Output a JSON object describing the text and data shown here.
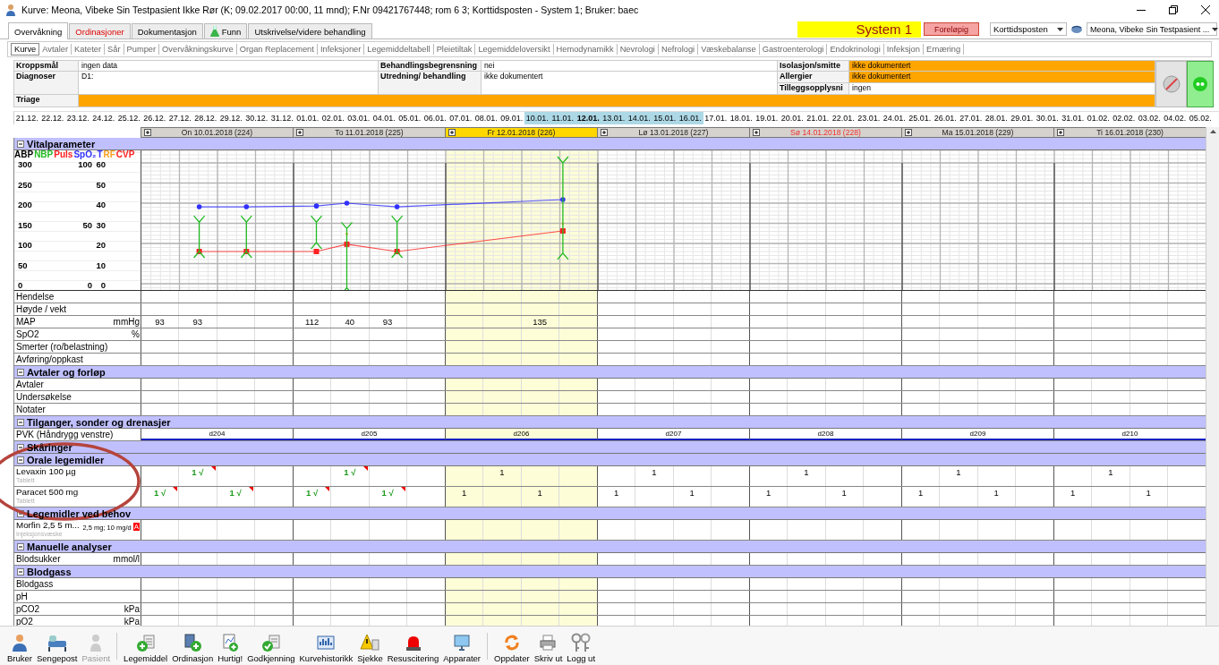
{
  "window": {
    "title": "Kurve: Meona, Vibeke Sin Testpasient Ikke Rør (K; 09.02.2017 00:00, 11 mnd); F.Nr 09421767448; rom 6 3; Korttidsposten - System 1; Bruker: baec"
  },
  "tabs": [
    {
      "label": "Overvåkning",
      "selected": true,
      "alert": false
    },
    {
      "label": "Ordinasjoner",
      "selected": false,
      "alert": true
    },
    {
      "label": "Dokumentasjon",
      "selected": false,
      "alert": false
    },
    {
      "label": "Funn",
      "selected": false,
      "alert": false
    },
    {
      "label": "Utskrivelse/videre behandling",
      "selected": false,
      "alert": false
    }
  ],
  "system_banner": {
    "label": "System 1",
    "status": "Foreløpig"
  },
  "unit_select": {
    "value": "Korttidsposten"
  },
  "patient_select": {
    "value": "Meona, Vibeke Sin Testpasient ..."
  },
  "subtabs": [
    {
      "label": "Kurve",
      "selected": true
    },
    {
      "label": "Avtaler",
      "selected": false
    },
    {
      "label": "Kateter",
      "selected": false
    },
    {
      "label": "Sår",
      "selected": false
    },
    {
      "label": "Pumper",
      "selected": false
    },
    {
      "label": "Overvåkningskurve",
      "selected": false
    },
    {
      "label": "Organ Replacement",
      "selected": false
    },
    {
      "label": "Infeksjoner",
      "selected": false
    },
    {
      "label": "Legemiddeltabell",
      "selected": false
    },
    {
      "label": "Pleietiltak",
      "selected": false
    },
    {
      "label": "Legemiddeloversikt",
      "selected": false
    },
    {
      "label": "Hemodynamikk",
      "selected": false
    },
    {
      "label": "Nevrologi",
      "selected": false
    },
    {
      "label": "Nefrologi",
      "selected": false
    },
    {
      "label": "Væskebalanse",
      "selected": false
    },
    {
      "label": "Gastroenterologi",
      "selected": false
    },
    {
      "label": "Endokrinologi",
      "selected": false
    },
    {
      "label": "Infeksjon",
      "selected": false
    },
    {
      "label": "Ernæring",
      "selected": false
    }
  ],
  "patient_info": [
    {
      "label": "Kroppsmål",
      "value": "ingen data",
      "alert": false
    },
    {
      "label": "Diagnoser",
      "value": "D1:",
      "alert": false
    },
    {
      "label": "Triage",
      "alert": true
    },
    {
      "label": "Behandlingsbegrensning",
      "value": "nei",
      "alert": false
    },
    {
      "label": "Utredning/ behandling",
      "value": "ikke dokumentert",
      "alert": false
    },
    {
      "label": "Isolasjon/smitte",
      "value": "ikke dokumentert",
      "alert": true
    },
    {
      "label": "Allergier",
      "value": "ikke dokumentert",
      "alert": true
    },
    {
      "label": "Tilleggsopplysni",
      "value": "ingen",
      "alert": false
    }
  ],
  "status_icons": [
    {
      "active": false
    },
    {
      "active": true
    }
  ],
  "date_strip": [
    {
      "label": "21.12.",
      "in_view": false,
      "current": false
    },
    {
      "label": "22.12.",
      "in_view": false,
      "current": false
    },
    {
      "label": "23.12.",
      "in_view": false,
      "current": false
    },
    {
      "label": "24.12.",
      "in_view": false,
      "current": false
    },
    {
      "label": "25.12.",
      "in_view": false,
      "current": false
    },
    {
      "label": "26.12.",
      "in_view": false,
      "current": false
    },
    {
      "label": "27.12.",
      "in_view": false,
      "current": false
    },
    {
      "label": "28.12.",
      "in_view": false,
      "current": false
    },
    {
      "label": "29.12.",
      "in_view": false,
      "current": false
    },
    {
      "label": "30.12.",
      "in_view": false,
      "current": false
    },
    {
      "label": "31.12.",
      "in_view": false,
      "current": false
    },
    {
      "label": "01.01.",
      "in_view": false,
      "current": false
    },
    {
      "label": "02.01.",
      "in_view": false,
      "current": false
    },
    {
      "label": "03.01.",
      "in_view": false,
      "current": false
    },
    {
      "label": "04.01.",
      "in_view": false,
      "current": false
    },
    {
      "label": "05.01.",
      "in_view": false,
      "current": false
    },
    {
      "label": "06.01.",
      "in_view": false,
      "current": false
    },
    {
      "label": "07.01.",
      "in_view": false,
      "current": false
    },
    {
      "label": "08.01.",
      "in_view": false,
      "current": false
    },
    {
      "label": "09.01.",
      "in_view": false,
      "current": false
    },
    {
      "label": "10.01.",
      "in_view": true,
      "current": false
    },
    {
      "label": "11.01.",
      "in_view": true,
      "current": false
    },
    {
      "label": "12.01.",
      "in_view": true,
      "current": true
    },
    {
      "label": "13.01.",
      "in_view": true,
      "current": false
    },
    {
      "label": "14.01.",
      "in_view": true,
      "current": false
    },
    {
      "label": "15.01.",
      "in_view": true,
      "current": false
    },
    {
      "label": "16.01.",
      "in_view": true,
      "current": false
    },
    {
      "label": "17.01.",
      "in_view": false,
      "current": false
    },
    {
      "label": "18.01.",
      "in_view": false,
      "current": false
    },
    {
      "label": "19.01.",
      "in_view": false,
      "current": false
    },
    {
      "label": "20.01.",
      "in_view": false,
      "current": false
    },
    {
      "label": "21.01.",
      "in_view": false,
      "current": false
    },
    {
      "label": "22.01.",
      "in_view": false,
      "current": false
    },
    {
      "label": "23.01.",
      "in_view": false,
      "current": false
    },
    {
      "label": "24.01.",
      "in_view": false,
      "current": false
    },
    {
      "label": "25.01.",
      "in_view": false,
      "current": false
    },
    {
      "label": "26.01.",
      "in_view": false,
      "current": false
    },
    {
      "label": "27.01.",
      "in_view": false,
      "current": false
    },
    {
      "label": "28.01.",
      "in_view": false,
      "current": false
    },
    {
      "label": "29.01.",
      "in_view": false,
      "current": false
    },
    {
      "label": "30.01.",
      "in_view": false,
      "current": false
    },
    {
      "label": "31.01.",
      "in_view": false,
      "current": false
    },
    {
      "label": "01.02.",
      "in_view": false,
      "current": false
    },
    {
      "label": "02.02.",
      "in_view": false,
      "current": false
    },
    {
      "label": "03.02.",
      "in_view": false,
      "current": false
    },
    {
      "label": "04.02.",
      "in_view": false,
      "current": false
    },
    {
      "label": "05.02.",
      "in_view": false,
      "current": false
    }
  ],
  "days": [
    {
      "label": "On 10.01.2018 (224)",
      "selected": false,
      "holiday": false
    },
    {
      "label": "To 11.01.2018 (225)",
      "selected": false,
      "holiday": false
    },
    {
      "label": "Fr 12.01.2018 (226)",
      "selected": true,
      "holiday": false
    },
    {
      "label": "Lø 13.01.2018 (227)",
      "selected": false,
      "holiday": false
    },
    {
      "label": "Sø 14.01.2018 (228)",
      "selected": false,
      "holiday": true
    },
    {
      "label": "Ma 15.01.2018 (229)",
      "selected": false,
      "holiday": false
    },
    {
      "label": "Ti 16.01.2018 (230)",
      "selected": false,
      "holiday": false
    }
  ],
  "sections": [
    {
      "title": "Vitalparameter",
      "expanded": true,
      "vitals": {
        "legend": [
          {
            "label": "ABP",
            "color": "#000000"
          },
          {
            "label": "NBP",
            "color": "#22bb22"
          },
          {
            "label": "Puls",
            "color": "#ff2020"
          },
          {
            "label": "SpO₂",
            "color": "#3030ff"
          },
          {
            "label": "T",
            "color": "#3030ff"
          },
          {
            "label": "RF",
            "color": "#ffa020"
          },
          {
            "label": "CVP",
            "color": "#ff2020"
          }
        ],
        "scale_rows": [
          {
            "abp": "300",
            "spo2": "100",
            "temp": "60"
          },
          {
            "abp": "250",
            "temp": "50"
          },
          {
            "abp": "200",
            "temp": "40"
          },
          {
            "abp": "150",
            "spo2": "50",
            "temp": "30"
          },
          {
            "abp": "100",
            "temp": "20"
          },
          {
            "abp": "50",
            "temp": "10"
          },
          {
            "abp": "0",
            "spo2": "0",
            "temp": "0"
          }
        ]
      },
      "rows": [
        {
          "label": "Hendelse",
          "kind": "plain"
        },
        {
          "label": "Høyde / vekt",
          "kind": "plain"
        },
        {
          "label": "MAP",
          "unit": "mmHg",
          "kind": "values",
          "days": [
            {
              "slot_1": "93",
              "slot_2": "93"
            },
            {
              "slot_1": "112",
              "slot_2": "40",
              "slot_3": "93"
            },
            {
              "slot_3": "135"
            }
          ]
        },
        {
          "label": "SpO2",
          "unit": "%",
          "kind": "plain"
        },
        {
          "label": "Smerter (ro/belastning)",
          "kind": "plain"
        },
        {
          "label": "Avføring/oppkast",
          "kind": "plain"
        }
      ]
    },
    {
      "title": "Avtaler og forløp",
      "expanded": true,
      "rows": [
        {
          "label": "Avtaler",
          "kind": "plain"
        },
        {
          "label": "Undersøkelse",
          "kind": "plain"
        },
        {
          "label": "Notater",
          "kind": "plain"
        }
      ]
    },
    {
      "title": "Tilganger, sonder og drenasjer",
      "expanded": true,
      "rows": [
        {
          "label": "PVK (Håndrygg venstre)",
          "kind": "line",
          "days": [
            "d204",
            "d205",
            "d206",
            "d207",
            "d208",
            "d209",
            "d210"
          ]
        }
      ]
    },
    {
      "title": "Skåringer",
      "expanded": true
    },
    {
      "title": "Orale legemidler",
      "expanded": true,
      "rows": [
        {
          "label": "Levaxin 100 µg",
          "form": "Tablett",
          "kind": "med",
          "days": [
            {
              "slot_2": {
                "text": "1 √",
                "given": true
              }
            },
            {
              "slot_2": {
                "text": "1 √",
                "given": true
              }
            },
            {
              "slot_2": {
                "text": "1",
                "given": false
              }
            },
            {
              "slot_2": {
                "text": "1",
                "given": false
              }
            },
            {
              "slot_2": {
                "text": "1",
                "given": false
              }
            },
            {
              "slot_2": {
                "text": "1",
                "given": false
              }
            },
            {
              "slot_2": {
                "text": "1",
                "given": false
              }
            }
          ]
        },
        {
          "label": "Paracet 500 mg",
          "form": "Tablett",
          "kind": "med",
          "days": [
            {
              "slot_1": {
                "text": "1 √",
                "given": true
              },
              "slot_3": {
                "text": "1 √",
                "given": true
              }
            },
            {
              "slot_1": {
                "text": "1 √",
                "given": true
              },
              "slot_3": {
                "text": "1 √",
                "given": true
              }
            },
            {
              "slot_1": {
                "text": "1",
                "given": false
              },
              "slot_3": {
                "text": "1",
                "given": false
              }
            },
            {
              "slot_1": {
                "text": "1",
                "given": false
              },
              "slot_3": {
                "text": "1",
                "given": false
              }
            },
            {
              "slot_1": {
                "text": "1",
                "given": false
              },
              "slot_3": {
                "text": "1",
                "given": false
              }
            },
            {
              "slot_1": {
                "text": "1",
                "given": false
              },
              "slot_3": {
                "text": "1",
                "given": false
              }
            },
            {
              "slot_1": {
                "text": "1",
                "given": false
              },
              "slot_3": {
                "text": "1",
                "given": false
              }
            }
          ]
        }
      ]
    },
    {
      "title": "Legemidler ved behov",
      "expanded": true,
      "rows": [
        {
          "label": "Morfin 2,5 5 m...",
          "form": "Injeksjonsvæske",
          "dose": "2,5 mg; 10 mg/d",
          "flag": "A",
          "kind": "med"
        }
      ]
    },
    {
      "title": "Manuelle analyser",
      "expanded": true,
      "rows": [
        {
          "label": "Blodsukker",
          "unit": "mmol/l",
          "kind": "plain"
        }
      ]
    },
    {
      "title": "Blodgass",
      "expanded": true,
      "rows": [
        {
          "label": "Blodgass",
          "kind": "plain"
        },
        {
          "label": "pH",
          "kind": "plain"
        },
        {
          "label": "pCO2",
          "unit": "kPa",
          "kind": "plain"
        },
        {
          "label": "pO2",
          "unit": "kPa",
          "kind": "plain"
        }
      ]
    }
  ],
  "toolbar": [
    {
      "label": "Bruker",
      "disabled": false,
      "separator_before": false
    },
    {
      "label": "Sengepost",
      "disabled": false,
      "separator_before": false
    },
    {
      "label": "Pasient",
      "disabled": true,
      "separator_before": false
    },
    {
      "label": "Legemiddel",
      "disabled": false,
      "separator_before": true
    },
    {
      "label": "Ordinasjon",
      "disabled": false,
      "separator_before": false
    },
    {
      "label": "Hurtig!",
      "disabled": false,
      "separator_before": false
    },
    {
      "label": "Godkjenning",
      "disabled": false,
      "separator_before": false
    },
    {
      "label": "Kurvehistorikk",
      "disabled": false,
      "separator_before": false
    },
    {
      "label": "Sjekke",
      "disabled": false,
      "separator_before": false
    },
    {
      "label": "Resuscitering",
      "disabled": false,
      "separator_before": false
    },
    {
      "label": "Apparater",
      "disabled": false,
      "separator_before": false
    },
    {
      "label": "Oppdater",
      "disabled": false,
      "separator_before": true
    },
    {
      "label": "Skriv ut",
      "disabled": false,
      "separator_before": false
    },
    {
      "label": "Logg ut",
      "disabled": false,
      "separator_before": false
    }
  ]
}
